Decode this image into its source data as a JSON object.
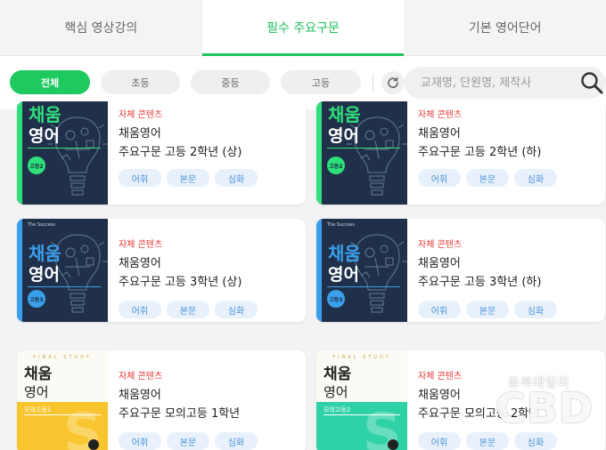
{
  "tabs": [
    {
      "label": "핵심 영상강의",
      "active": false
    },
    {
      "label": "필수 주요구문",
      "active": true
    },
    {
      "label": "기본 영어단어",
      "active": false
    }
  ],
  "filters": {
    "chips": [
      "전체",
      "초등",
      "중등",
      "고등"
    ],
    "active": "전체",
    "search_placeholder": "교재명, 단원명, 제작사",
    "refresh_icon": "refresh-icon",
    "search_icon": "search-icon"
  },
  "colors": {
    "accent": "#1ec95f",
    "tag_bg": "#e8f1fb",
    "tag_text": "#4a90d9",
    "own_label": "#e53935",
    "cover_dark": "#20304a",
    "stripe_green": "#2ee07a",
    "stripe_blue": "#3aa0ec",
    "final_yellow": "#f8c52e",
    "final_teal": "#2fd1a6"
  },
  "cards": [
    {
      "own_label": "자체 콘텐츠",
      "title_line1": "채움영어",
      "title_line2": "주요구문 고등 2학년 (상)",
      "tags": [
        "어휘",
        "본문",
        "심화"
      ],
      "cover": {
        "style": "dark",
        "text1": "채움",
        "text2": "영어",
        "badge": "고등2",
        "stripe": "green"
      }
    },
    {
      "own_label": "자체 콘텐츠",
      "title_line1": "채움영어",
      "title_line2": "주요구문 고등 2학년 (하)",
      "tags": [
        "어휘",
        "본문",
        "심화"
      ],
      "cover": {
        "style": "dark",
        "text1": "채움",
        "text2": "영어",
        "badge": "고등2",
        "stripe": "green"
      }
    },
    {
      "own_label": "자체 콘텐츠",
      "title_line1": "채움영어",
      "title_line2": "주요구문 고등 3학년 (상)",
      "tags": [
        "어휘",
        "본문",
        "심화"
      ],
      "cover": {
        "style": "dark",
        "text1": "채움",
        "text2": "영어",
        "badge": "고등3",
        "stripe": "blue",
        "brand": "The Success"
      }
    },
    {
      "own_label": "자체 콘텐츠",
      "title_line1": "채움영어",
      "title_line2": "주요구문 고등 3학년 (하)",
      "tags": [
        "어휘",
        "본문",
        "심화"
      ],
      "cover": {
        "style": "dark",
        "text1": "채움",
        "text2": "영어",
        "badge": "고등3",
        "stripe": "blue",
        "brand": "The Success"
      }
    },
    {
      "own_label": "자체 콘텐츠",
      "title_line1": "채움영어",
      "title_line2": "주요구문 모의고등 1학년",
      "tags": [
        "어휘",
        "본문",
        "심화"
      ],
      "cover": {
        "style": "final",
        "top": "FINAL STUDY",
        "text1": "채움",
        "text2": "영어",
        "badge": "모의고등1",
        "color": "yellow"
      }
    },
    {
      "own_label": "자체 콘텐츠",
      "title_line1": "채움영어",
      "title_line2": "주요구문 모의고등 2학년",
      "tags": [
        "어휘",
        "본문",
        "심화"
      ],
      "cover": {
        "style": "final",
        "top": "FINAL STUDY",
        "text1": "채움",
        "text2": "영어",
        "badge": "모의고등2",
        "color": "teal"
      }
    }
  ],
  "watermark": {
    "small": "충북데일리",
    "big": "CBD"
  }
}
